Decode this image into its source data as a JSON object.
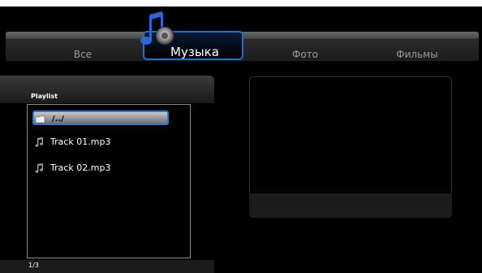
{
  "tabs": {
    "all": "Все",
    "music": "Музыка",
    "photo": "Фото",
    "films": "Фильмы"
  },
  "playlist": {
    "title": "Playlist",
    "items": [
      {
        "label": "/../",
        "icon": "folder-icon",
        "selected": true
      },
      {
        "label": "Track 01.mp3",
        "icon": "music-note-icon",
        "selected": false
      },
      {
        "label": "Track 02.mp3",
        "icon": "music-note-icon",
        "selected": false
      }
    ],
    "page": "1/3"
  },
  "colors": {
    "accent": "#1e6fd0",
    "background": "#000000"
  }
}
